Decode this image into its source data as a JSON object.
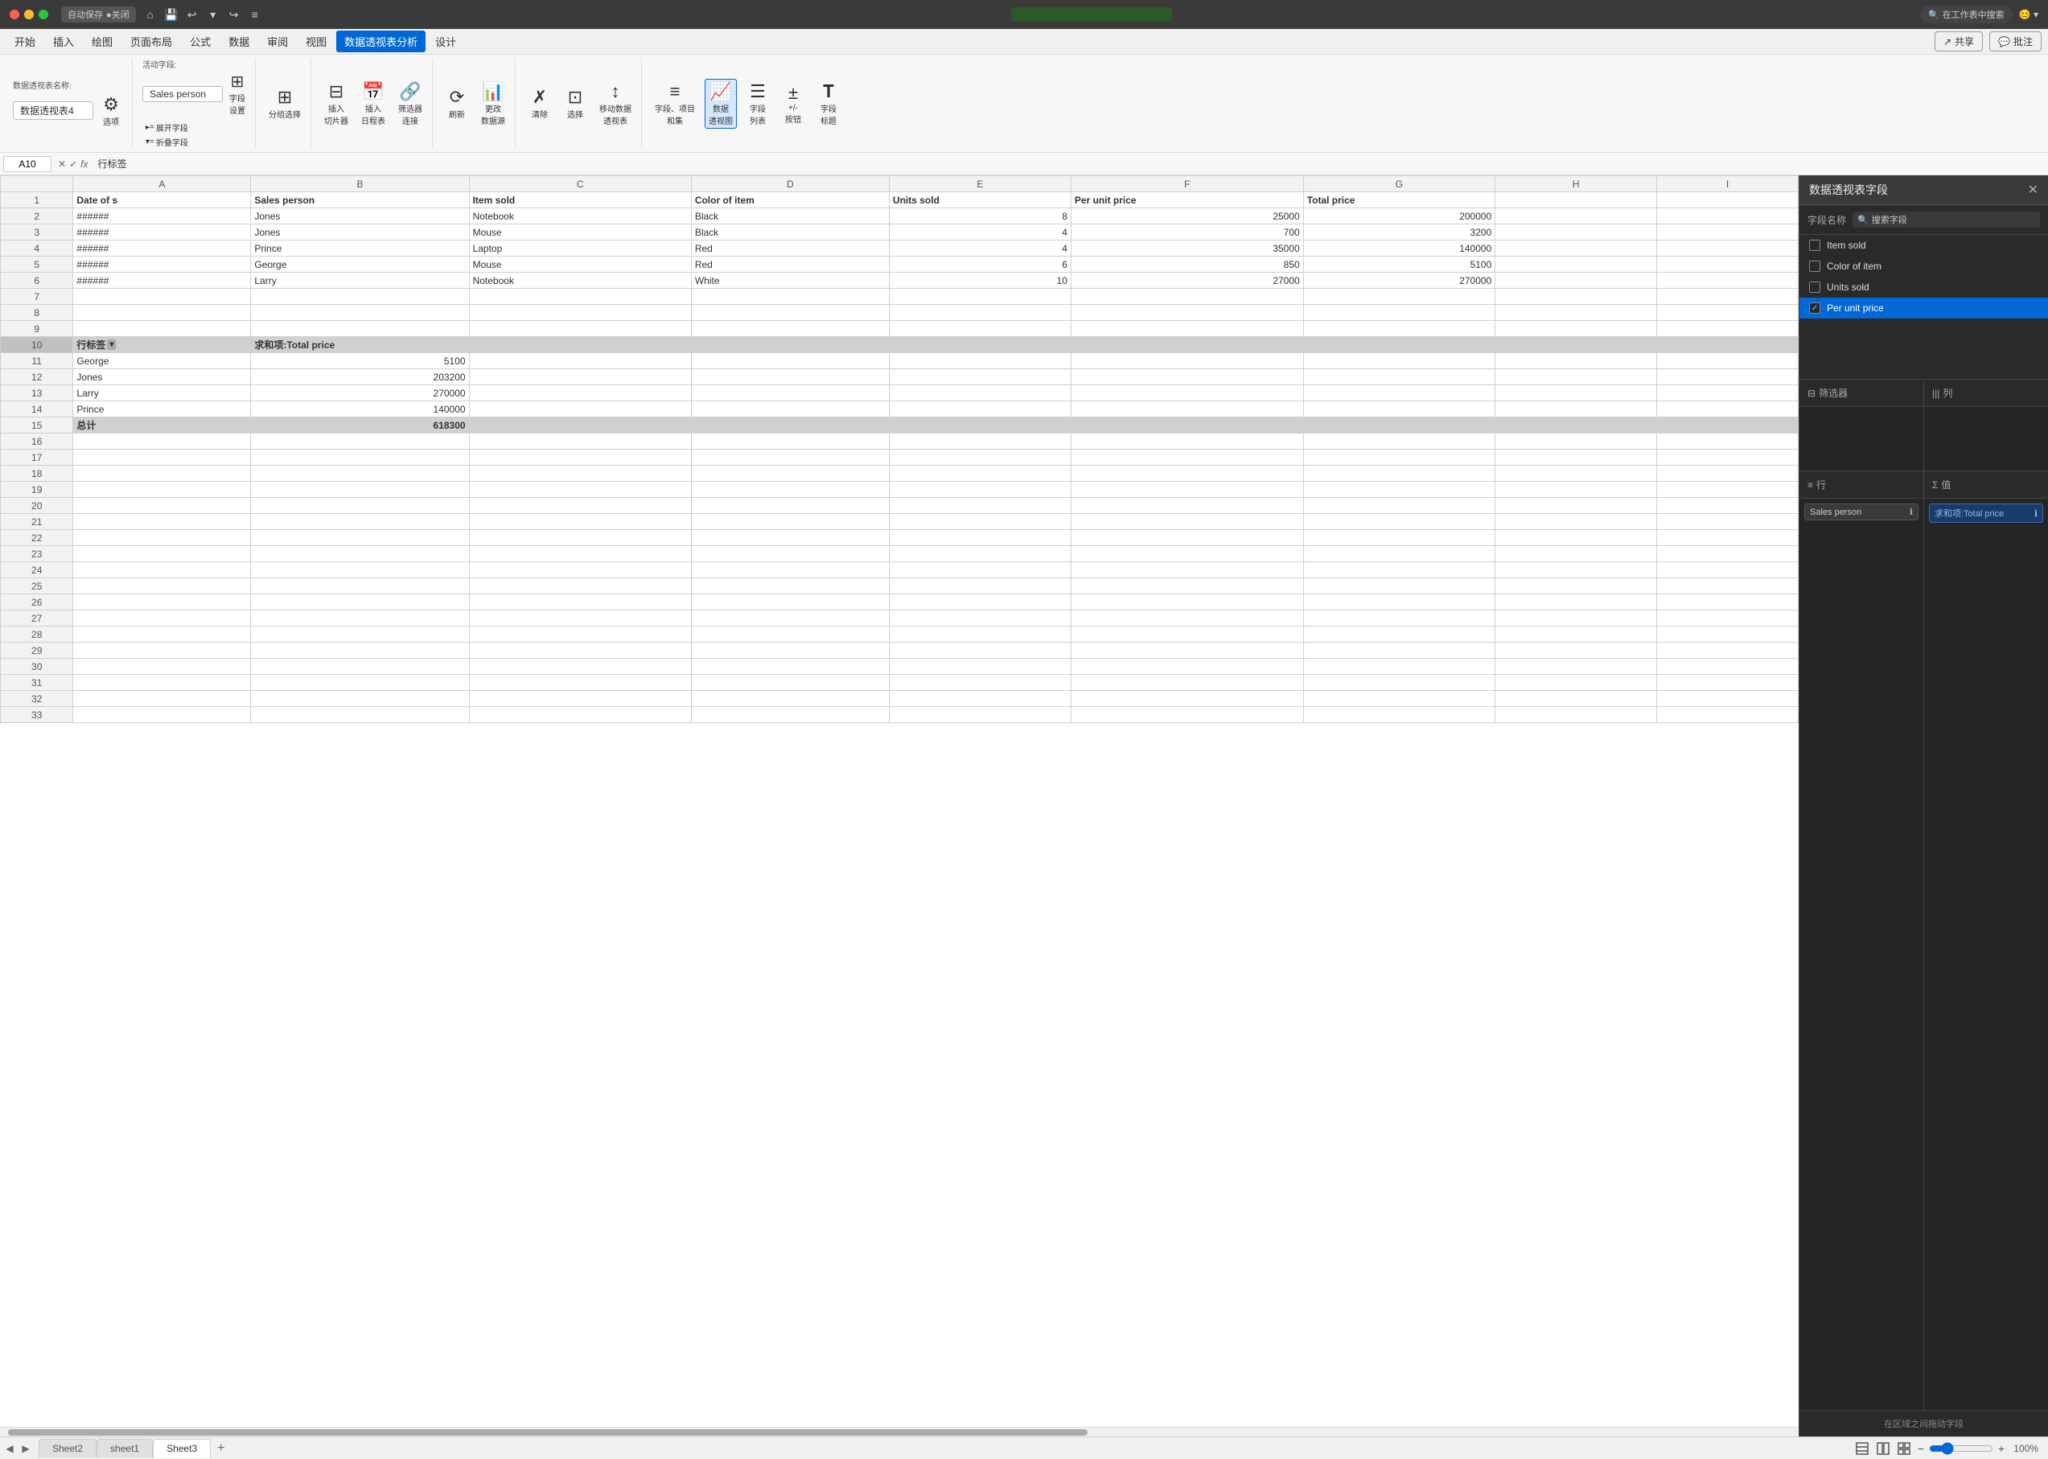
{
  "titlebar": {
    "autosave_label": "自动保存",
    "autosave_state": "●关闭",
    "title": "",
    "search_placeholder": "在工作表中搜索"
  },
  "menubar": {
    "items": [
      "开始",
      "插入",
      "绘图",
      "页面布局",
      "公式",
      "数据",
      "审阅",
      "视图",
      "数据透视表分析",
      "设计"
    ],
    "active_item": "数据透视表分析",
    "share_label": "共享",
    "comment_label": "批注"
  },
  "ribbon": {
    "pivot_name_label": "数据透视表名称:",
    "pivot_name_value": "数据透视表4",
    "options_label": "选项",
    "active_field_label": "活动字段:",
    "active_field_value": "Sales person",
    "field_settings_label": "字段\n设置",
    "expand_label": "▸= 展开字段",
    "collapse_label": "▾= 折叠字段",
    "group_select_label": "分组选择",
    "insert_slicer_label": "插入\n切片器",
    "insert_timeline_label": "插入\n日程表",
    "filter_conn_label": "筛选器\n连接",
    "refresh_label": "刷新",
    "change_source_label": "更改\n数据源",
    "clear_label": "清除",
    "select_label": "选择",
    "move_pivot_label": "移动数据\n透视表",
    "field_list_label": "字段、项目\n和集",
    "pivot_chart_label": "数据\n透视图",
    "field_headers_label": "字段\n列表",
    "plus_minus_label": "+/-\n按钮",
    "field_names_label": "字段\n标题"
  },
  "formulabar": {
    "cell_ref": "A10",
    "formula": "行标签"
  },
  "grid": {
    "col_headers": [
      "",
      "A",
      "B",
      "C",
      "D",
      "E",
      "F",
      "G",
      "H",
      "I"
    ],
    "rows": [
      {
        "row": 1,
        "cells": [
          "Date of s",
          "Sales person",
          "Item sold",
          "Color of item",
          "Units sold",
          "Per unit price",
          "Total price",
          "",
          ""
        ]
      },
      {
        "row": 2,
        "cells": [
          "######",
          "Jones",
          "Notebook",
          "Black",
          "8",
          "25000",
          "200000",
          "",
          ""
        ]
      },
      {
        "row": 3,
        "cells": [
          "######",
          "Jones",
          "Mouse",
          "Black",
          "4",
          "700",
          "3200",
          "",
          ""
        ]
      },
      {
        "row": 4,
        "cells": [
          "######",
          "Prince",
          "Laptop",
          "Red",
          "4",
          "35000",
          "140000",
          "",
          ""
        ]
      },
      {
        "row": 5,
        "cells": [
          "######",
          "George",
          "Mouse",
          "Red",
          "6",
          "850",
          "5100",
          "",
          ""
        ]
      },
      {
        "row": 6,
        "cells": [
          "######",
          "Larry",
          "Notebook",
          "White",
          "10",
          "27000",
          "270000",
          "",
          ""
        ]
      },
      {
        "row": 7,
        "cells": [
          "",
          "",
          "",
          "",
          "",
          "",
          "",
          "",
          ""
        ]
      },
      {
        "row": 8,
        "cells": [
          "",
          "",
          "",
          "",
          "",
          "",
          "",
          "",
          ""
        ]
      },
      {
        "row": 9,
        "cells": [
          "",
          "",
          "",
          "",
          "",
          "",
          "",
          "",
          ""
        ]
      },
      {
        "row": 10,
        "cells": [
          "行标签",
          "求和项:Total price",
          "",
          "",
          "",
          "",
          "",
          "",
          ""
        ],
        "type": "pivot-header"
      },
      {
        "row": 11,
        "cells": [
          "George",
          "5100",
          "",
          "",
          "",
          "",
          "",
          "",
          ""
        ]
      },
      {
        "row": 12,
        "cells": [
          "Jones",
          "203200",
          "",
          "",
          "",
          "",
          "",
          "",
          ""
        ]
      },
      {
        "row": 13,
        "cells": [
          "Larry",
          "270000",
          "",
          "",
          "",
          "",
          "",
          "",
          ""
        ]
      },
      {
        "row": 14,
        "cells": [
          "Prince",
          "140000",
          "",
          "",
          "",
          "",
          "",
          "",
          ""
        ]
      },
      {
        "row": 15,
        "cells": [
          "总计",
          "618300",
          "",
          "",
          "",
          "",
          "",
          "",
          ""
        ],
        "type": "pivot-total"
      },
      {
        "row": 16,
        "cells": [
          "",
          "",
          "",
          "",
          "",
          "",
          "",
          "",
          ""
        ]
      },
      {
        "row": 17,
        "cells": [
          "",
          "",
          "",
          "",
          "",
          "",
          "",
          "",
          ""
        ]
      },
      {
        "row": 18,
        "cells": [
          "",
          "",
          "",
          "",
          "",
          "",
          "",
          "",
          ""
        ]
      },
      {
        "row": 19,
        "cells": [
          "",
          "",
          "",
          "",
          "",
          "",
          "",
          "",
          ""
        ]
      },
      {
        "row": 20,
        "cells": [
          "",
          "",
          "",
          "",
          "",
          "",
          "",
          "",
          ""
        ]
      },
      {
        "row": 21,
        "cells": [
          "",
          "",
          "",
          "",
          "",
          "",
          "",
          "",
          ""
        ]
      },
      {
        "row": 22,
        "cells": [
          "",
          "",
          "",
          "",
          "",
          "",
          "",
          "",
          ""
        ]
      },
      {
        "row": 23,
        "cells": [
          "",
          "",
          "",
          "",
          "",
          "",
          "",
          "",
          ""
        ]
      },
      {
        "row": 24,
        "cells": [
          "",
          "",
          "",
          "",
          "",
          "",
          "",
          "",
          ""
        ]
      },
      {
        "row": 25,
        "cells": [
          "",
          "",
          "",
          "",
          "",
          "",
          "",
          "",
          ""
        ]
      },
      {
        "row": 26,
        "cells": [
          "",
          "",
          "",
          "",
          "",
          "",
          "",
          "",
          ""
        ]
      },
      {
        "row": 27,
        "cells": [
          "",
          "",
          "",
          "",
          "",
          "",
          "",
          "",
          ""
        ]
      },
      {
        "row": 28,
        "cells": [
          "",
          "",
          "",
          "",
          "",
          "",
          "",
          "",
          ""
        ]
      },
      {
        "row": 29,
        "cells": [
          "",
          "",
          "",
          "",
          "",
          "",
          "",
          "",
          ""
        ]
      },
      {
        "row": 30,
        "cells": [
          "",
          "",
          "",
          "",
          "",
          "",
          "",
          "",
          ""
        ]
      },
      {
        "row": 31,
        "cells": [
          "",
          "",
          "",
          "",
          "",
          "",
          "",
          "",
          ""
        ]
      },
      {
        "row": 32,
        "cells": [
          "",
          "",
          "",
          "",
          "",
          "",
          "",
          "",
          ""
        ]
      },
      {
        "row": 33,
        "cells": [
          "",
          "",
          "",
          "",
          "",
          "",
          "",
          "",
          ""
        ]
      }
    ]
  },
  "pivot_panel": {
    "title": "数据透视表字段",
    "search_label": "字段名称",
    "search_placeholder": "搜索字段",
    "fields": [
      {
        "id": "item_sold",
        "label": "Item sold",
        "checked": false
      },
      {
        "id": "color_of_item",
        "label": "Color of item",
        "checked": false
      },
      {
        "id": "units_sold",
        "label": "Units sold",
        "checked": false
      },
      {
        "id": "per_unit_price",
        "label": "Per unit price",
        "checked": true,
        "selected": true
      }
    ],
    "zones": {
      "filter_label": "筛选器",
      "cols_label": "列",
      "rows_label": "行",
      "values_label": "值",
      "rows_tag": "Sales person",
      "values_tag": "求和项:Total price"
    },
    "footer": "在区域之间拖动字段"
  },
  "sheet_tabs": {
    "tabs": [
      "Sheet2",
      "sheet1",
      "Sheet3"
    ],
    "active_tab": "Sheet3"
  },
  "statusbar": {
    "zoom": "100%"
  }
}
